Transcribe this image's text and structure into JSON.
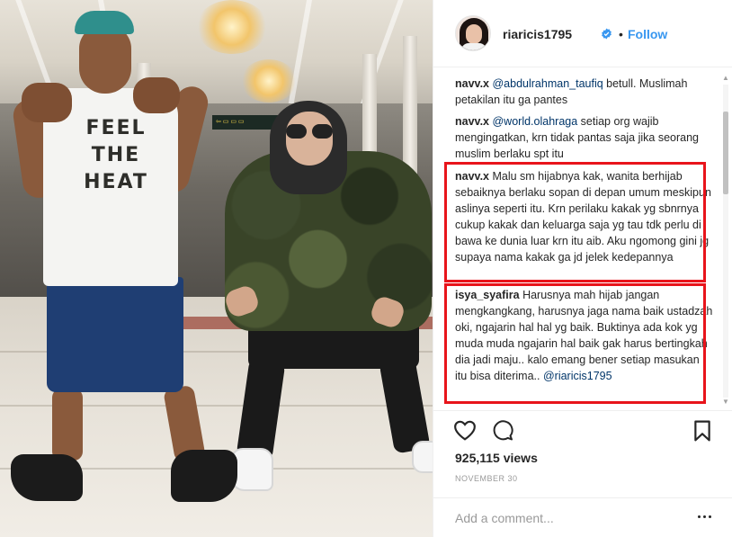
{
  "post": {
    "username": "riaricis1795",
    "separator": "•",
    "follow_label": "Follow",
    "views": "925,115 views",
    "date": "NOVEMBER 30",
    "shirt_text": "FEEL THE HEAT"
  },
  "comments": [
    {
      "user": "navv.x",
      "mention": "@abdulrahman_taufiq",
      "text": " betull. Muslimah petakilan itu ga pantes"
    },
    {
      "user": "navv.x",
      "mention": "@world.olahraga",
      "text": " setiap org wajib mengingatkan, krn tidak pantas saja jika seorang muslim berlaku spt itu"
    },
    {
      "user": "navv.x",
      "mention": "",
      "text": " Malu sm hijabnya kak, wanita berhijab sebaiknya berlaku sopan di depan umum meskipun aslinya seperti itu. Krn perilaku kakak yg sbnrnya cukup kakak dan keluarga saja yg tau tdk perlu di bawa ke dunia luar krn itu aib. Aku ngomong gini jg supaya nama kakak ga jd jelek kedepannya"
    },
    {
      "user": "isya_syafira",
      "mention": "",
      "text": " Harusnya mah hijab jangan mengkangkang, harusnya jaga nama baik ustadzah oki, ngajarin hal hal yg baik. Buktinya ada kok yg muda muda ngajarin hal baik gak harus bertingkah dia jadi maju.. kalo emang bener setiap masukan itu bisa diterima.. ",
      "trailing_mention": "@riaricis1795"
    }
  ],
  "add_comment": {
    "placeholder": "Add a comment..."
  },
  "icons": [
    "heart-icon",
    "comment-icon",
    "bookmark-icon",
    "verified-badge-icon",
    "more-options-icon"
  ],
  "colors": {
    "link": "#3897f0",
    "mention": "#003569",
    "highlight": "#e8141b",
    "meta": "#999999"
  }
}
